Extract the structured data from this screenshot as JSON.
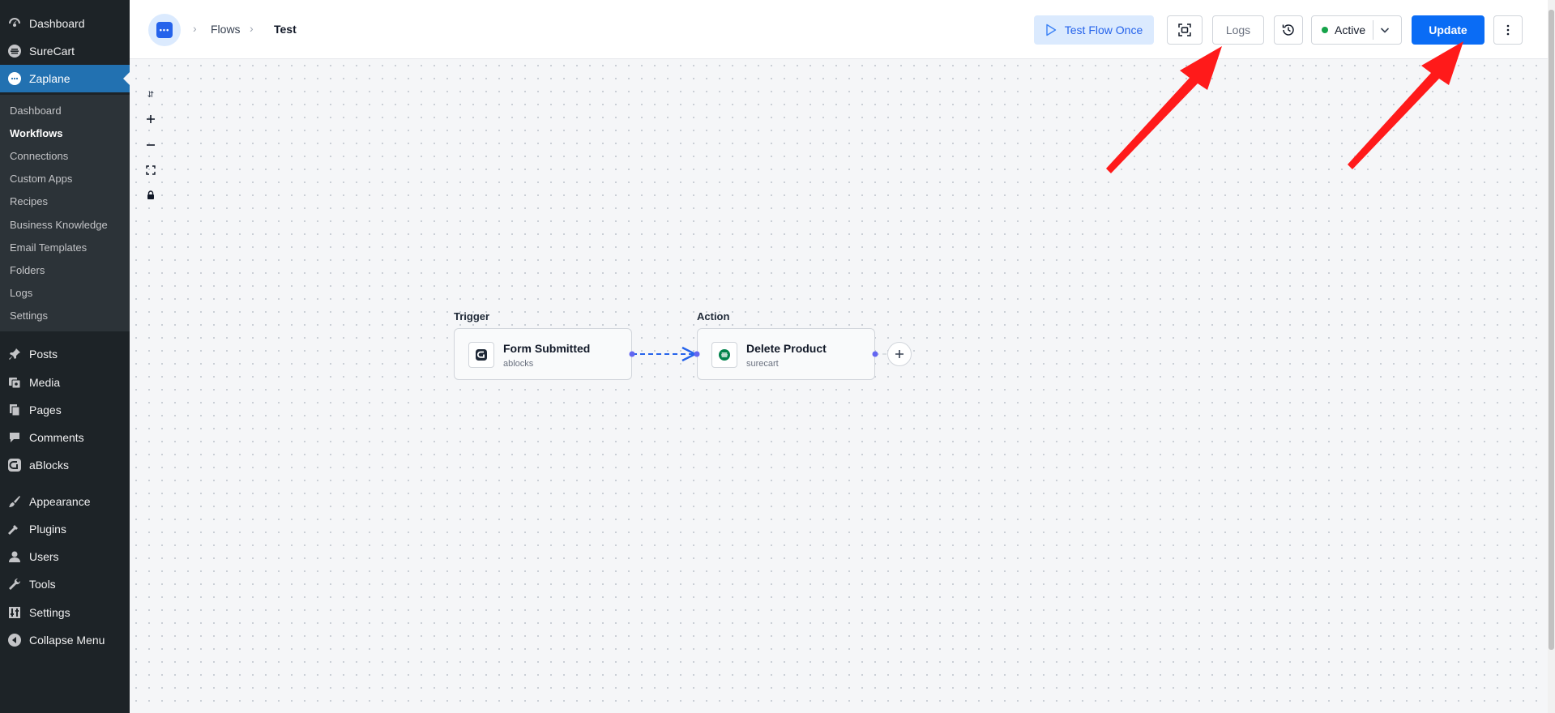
{
  "sidebar": {
    "top_items": [
      {
        "label": "Dashboard",
        "icon": "dashboard-icon"
      },
      {
        "label": "SureCart",
        "icon": "surecart-icon"
      },
      {
        "label": "Zaplane",
        "icon": "zaplane-icon"
      }
    ],
    "submenu": [
      "Dashboard",
      "Workflows",
      "Connections",
      "Custom Apps",
      "Recipes",
      "Business Knowledge",
      "Email Templates",
      "Folders",
      "Logs",
      "Settings"
    ],
    "bottom_items": [
      {
        "label": "Posts",
        "icon": "pin-icon"
      },
      {
        "label": "Media",
        "icon": "media-icon"
      },
      {
        "label": "Pages",
        "icon": "pages-icon"
      },
      {
        "label": "Comments",
        "icon": "comment-icon"
      },
      {
        "label": "aBlocks",
        "icon": "ablocks-icon"
      },
      {
        "label": "Appearance",
        "icon": "brush-icon"
      },
      {
        "label": "Plugins",
        "icon": "plug-icon"
      },
      {
        "label": "Users",
        "icon": "user-icon"
      },
      {
        "label": "Tools",
        "icon": "wrench-icon"
      },
      {
        "label": "Settings",
        "icon": "settings-icon"
      },
      {
        "label": "Collapse Menu",
        "icon": "collapse-icon"
      }
    ]
  },
  "header": {
    "breadcrumb": [
      "Flows",
      "Test"
    ],
    "test_flow_label": "Test Flow Once",
    "logs_label": "Logs",
    "status_label": "Active",
    "update_label": "Update"
  },
  "flow": {
    "trigger": {
      "section": "Trigger",
      "title": "Form Submitted",
      "app": "ablocks"
    },
    "action": {
      "section": "Action",
      "title": "Delete Product",
      "app": "surecart"
    }
  },
  "colors": {
    "sidebar_bg": "#1d2327",
    "accent": "#0a6cf5",
    "status_active": "#16a34a",
    "annotation_arrow": "#ff1a1a"
  }
}
